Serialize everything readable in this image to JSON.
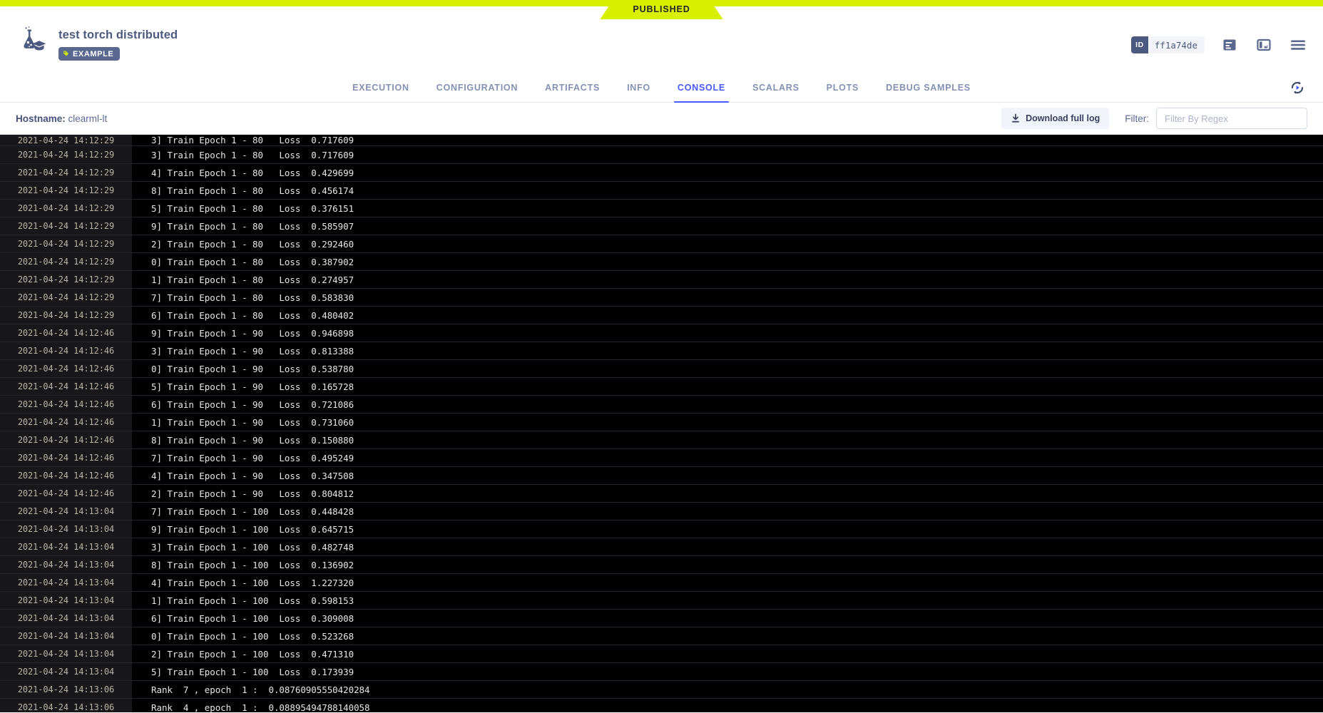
{
  "status_ribbon": {
    "label": "PUBLISHED",
    "color": "#d8f000"
  },
  "header": {
    "title": "test torch distributed",
    "tag": "EXAMPLE",
    "id_key": "ID",
    "id_value": "ff1a74de",
    "icons": [
      "log-view-icon",
      "split-view-icon",
      "menu-icon"
    ]
  },
  "tabs": [
    {
      "label": "EXECUTION",
      "active": false
    },
    {
      "label": "CONFIGURATION",
      "active": false
    },
    {
      "label": "ARTIFACTS",
      "active": false
    },
    {
      "label": "INFO",
      "active": false
    },
    {
      "label": "CONSOLE",
      "active": true
    },
    {
      "label": "SCALARS",
      "active": false
    },
    {
      "label": "PLOTS",
      "active": false
    },
    {
      "label": "DEBUG SAMPLES",
      "active": false
    }
  ],
  "toolbar": {
    "hostname_label": "Hostname:",
    "hostname_value": "clearml-lt",
    "download_label": "Download full log",
    "filter_label": "Filter:",
    "filter_value": "",
    "filter_placeholder": "Filter By Regex"
  },
  "console_log": [
    {
      "ts": "2021-04-24 14:12:29",
      "msg": "3] Train Epoch 1 - 80   Loss  0.717609",
      "partial": true
    },
    {
      "ts": "2021-04-24 14:12:29",
      "msg": "3] Train Epoch 1 - 80   Loss  0.717609"
    },
    {
      "ts": "2021-04-24 14:12:29",
      "msg": "4] Train Epoch 1 - 80   Loss  0.429699"
    },
    {
      "ts": "2021-04-24 14:12:29",
      "msg": "8] Train Epoch 1 - 80   Loss  0.456174"
    },
    {
      "ts": "2021-04-24 14:12:29",
      "msg": "5] Train Epoch 1 - 80   Loss  0.376151"
    },
    {
      "ts": "2021-04-24 14:12:29",
      "msg": "9] Train Epoch 1 - 80   Loss  0.585907"
    },
    {
      "ts": "2021-04-24 14:12:29",
      "msg": "2] Train Epoch 1 - 80   Loss  0.292460"
    },
    {
      "ts": "2021-04-24 14:12:29",
      "msg": "0] Train Epoch 1 - 80   Loss  0.387902"
    },
    {
      "ts": "2021-04-24 14:12:29",
      "msg": "1] Train Epoch 1 - 80   Loss  0.274957"
    },
    {
      "ts": "2021-04-24 14:12:29",
      "msg": "7] Train Epoch 1 - 80   Loss  0.583830"
    },
    {
      "ts": "2021-04-24 14:12:29",
      "msg": "6] Train Epoch 1 - 80   Loss  0.480402"
    },
    {
      "ts": "2021-04-24 14:12:46",
      "msg": "9] Train Epoch 1 - 90   Loss  0.946898"
    },
    {
      "ts": "2021-04-24 14:12:46",
      "msg": "3] Train Epoch 1 - 90   Loss  0.813388"
    },
    {
      "ts": "2021-04-24 14:12:46",
      "msg": "0] Train Epoch 1 - 90   Loss  0.538780"
    },
    {
      "ts": "2021-04-24 14:12:46",
      "msg": "5] Train Epoch 1 - 90   Loss  0.165728"
    },
    {
      "ts": "2021-04-24 14:12:46",
      "msg": "6] Train Epoch 1 - 90   Loss  0.721086"
    },
    {
      "ts": "2021-04-24 14:12:46",
      "msg": "1] Train Epoch 1 - 90   Loss  0.731060"
    },
    {
      "ts": "2021-04-24 14:12:46",
      "msg": "8] Train Epoch 1 - 90   Loss  0.150880"
    },
    {
      "ts": "2021-04-24 14:12:46",
      "msg": "7] Train Epoch 1 - 90   Loss  0.495249"
    },
    {
      "ts": "2021-04-24 14:12:46",
      "msg": "4] Train Epoch 1 - 90   Loss  0.347508"
    },
    {
      "ts": "2021-04-24 14:12:46",
      "msg": "2] Train Epoch 1 - 90   Loss  0.804812"
    },
    {
      "ts": "2021-04-24 14:13:04",
      "msg": "7] Train Epoch 1 - 100  Loss  0.448428"
    },
    {
      "ts": "2021-04-24 14:13:04",
      "msg": "9] Train Epoch 1 - 100  Loss  0.645715"
    },
    {
      "ts": "2021-04-24 14:13:04",
      "msg": "3] Train Epoch 1 - 100  Loss  0.482748"
    },
    {
      "ts": "2021-04-24 14:13:04",
      "msg": "8] Train Epoch 1 - 100  Loss  0.136902"
    },
    {
      "ts": "2021-04-24 14:13:04",
      "msg": "4] Train Epoch 1 - 100  Loss  1.227320"
    },
    {
      "ts": "2021-04-24 14:13:04",
      "msg": "1] Train Epoch 1 - 100  Loss  0.598153"
    },
    {
      "ts": "2021-04-24 14:13:04",
      "msg": "6] Train Epoch 1 - 100  Loss  0.309008"
    },
    {
      "ts": "2021-04-24 14:13:04",
      "msg": "0] Train Epoch 1 - 100  Loss  0.523268"
    },
    {
      "ts": "2021-04-24 14:13:04",
      "msg": "2] Train Epoch 1 - 100  Loss  0.471310"
    },
    {
      "ts": "2021-04-24 14:13:04",
      "msg": "5] Train Epoch 1 - 100  Loss  0.173939"
    },
    {
      "ts": "2021-04-24 14:13:06",
      "msg": "Rank  7 , epoch  1 :  0.08760905550420284"
    },
    {
      "ts": "2021-04-24 14:13:06",
      "msg": "Rank  4 , epoch  1 :  0.08895494788140058"
    }
  ]
}
